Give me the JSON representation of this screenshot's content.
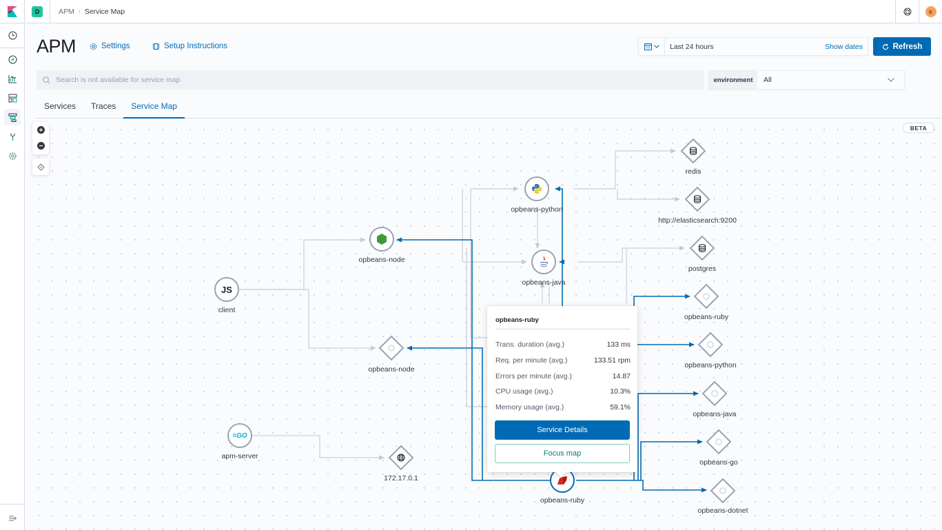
{
  "header": {
    "space_initial": "D",
    "breadcrumbs": [
      "APM",
      "Service Map"
    ],
    "user_initial": "e",
    "icons": {
      "logo": "kibana-logo",
      "help": "help-icon"
    }
  },
  "sidebar": {
    "items": [
      {
        "name": "recently-viewed",
        "icon": "clock-icon"
      },
      {
        "name": "discover",
        "icon": "compass-icon"
      },
      {
        "name": "visualize",
        "icon": "chart-icon"
      },
      {
        "name": "dashboard",
        "icon": "dashboard-icon"
      },
      {
        "name": "apm",
        "icon": "apm-icon",
        "active": true
      },
      {
        "name": "dev-tools",
        "icon": "wrench-icon"
      },
      {
        "name": "management",
        "icon": "gear-icon"
      }
    ],
    "collapse_icon": "dock-icon"
  },
  "page": {
    "title": "APM",
    "settings_label": "Settings",
    "setup_label": "Setup Instructions"
  },
  "datepicker": {
    "range": "Last 24 hours",
    "show_dates": "Show dates",
    "refresh_label": "Refresh"
  },
  "search": {
    "placeholder": "Search is not available for service map"
  },
  "environment": {
    "label": "environment",
    "value": "All"
  },
  "tabs": [
    {
      "label": "Services",
      "active": false
    },
    {
      "label": "Traces",
      "active": false
    },
    {
      "label": "Service Map",
      "active": true
    }
  ],
  "map": {
    "beta_label": "BETA",
    "nodes": [
      {
        "id": "client",
        "label": "client",
        "type": "service",
        "agent": "js"
      },
      {
        "id": "node-svc",
        "label": "opbeans-node",
        "type": "service",
        "agent": "nodejs"
      },
      {
        "id": "node-ext",
        "label": "opbeans-node",
        "type": "external"
      },
      {
        "id": "python-svc",
        "label": "opbeans-python",
        "type": "service",
        "agent": "python"
      },
      {
        "id": "java-svc",
        "label": "opbeans-java",
        "type": "service",
        "agent": "java"
      },
      {
        "id": "ruby-svc",
        "label": "opbeans-ruby",
        "type": "service",
        "agent": "ruby",
        "selected": true
      },
      {
        "id": "apm-server",
        "label": "apm-server",
        "type": "service",
        "agent": "go"
      },
      {
        "id": "ip",
        "label": "172.17.0.1",
        "type": "external",
        "icon": "globe"
      },
      {
        "id": "redis",
        "label": "redis",
        "type": "database"
      },
      {
        "id": "es",
        "label": "http://elasticsearch:9200",
        "type": "database"
      },
      {
        "id": "postgres",
        "label": "postgres",
        "type": "database"
      },
      {
        "id": "ext-ruby",
        "label": "opbeans-ruby",
        "type": "external"
      },
      {
        "id": "ext-python",
        "label": "opbeans-python",
        "type": "external"
      },
      {
        "id": "ext-java",
        "label": "opbeans-java",
        "type": "external"
      },
      {
        "id": "ext-go",
        "label": "opbeans-go",
        "type": "external"
      },
      {
        "id": "ext-dotnet",
        "label": "opbeans-dotnet",
        "type": "external"
      }
    ]
  },
  "popover": {
    "title": "opbeans-ruby",
    "metrics": [
      {
        "label": "Trans. duration (avg.)",
        "value": "133 ms"
      },
      {
        "label": "Req. per minute (avg.)",
        "value": "133.51 rpm"
      },
      {
        "label": "Errors per minute (avg.)",
        "value": "14.87"
      },
      {
        "label": "CPU usage (avg.)",
        "value": "10.3%"
      },
      {
        "label": "Memory usage (avg.)",
        "value": "59.1%"
      }
    ],
    "details_button": "Service Details",
    "focus_button": "Focus map"
  },
  "colors": {
    "accent": "#006bb4",
    "edge": "#c2cad6",
    "node_border": "#98a2b3",
    "focus": "#017d73"
  }
}
